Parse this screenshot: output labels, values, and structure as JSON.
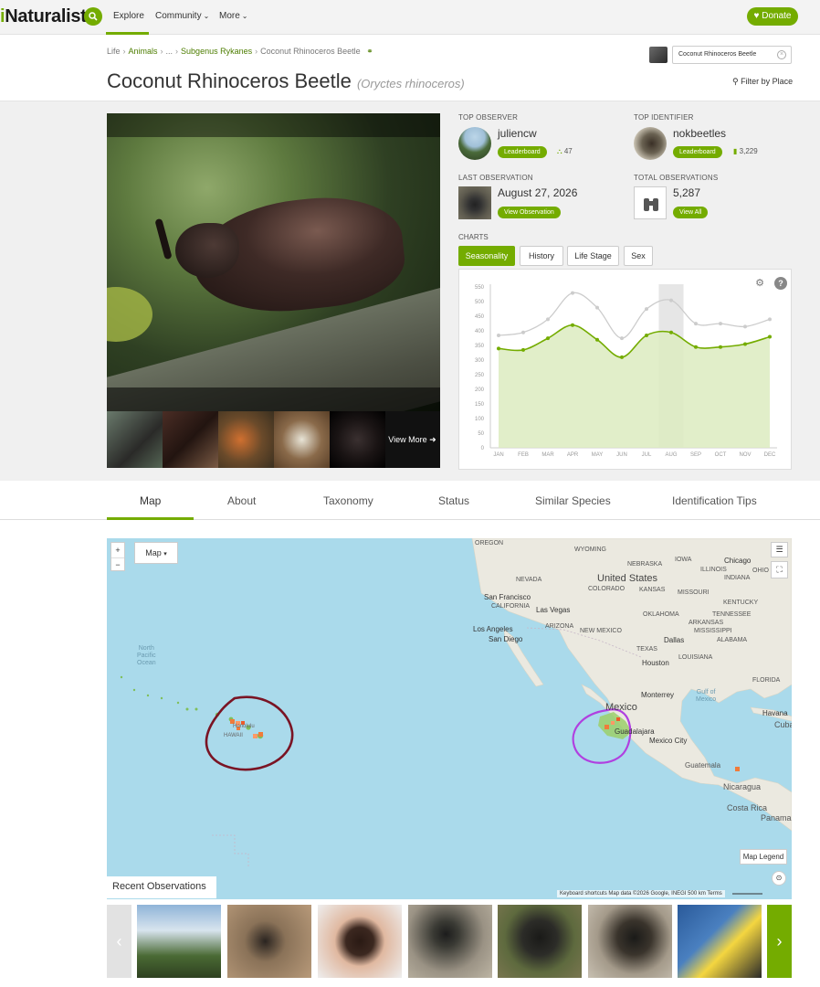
{
  "nav": {
    "logo_prefix": "i",
    "logo_rest": "Naturalist",
    "explore": "Explore",
    "community": "Community",
    "more": "More",
    "donate": "Donate"
  },
  "breadcrumb": {
    "life": "Life",
    "animals": "Animals",
    "ellipsis": "...",
    "subgenus": "Subgenus Rykanes",
    "current": "Coconut Rhinoceros Beetle"
  },
  "taxon": {
    "common_name": "Coconut Rhinoceros Beetle",
    "scientific_name": "(Oryctes rhinoceros)"
  },
  "search": {
    "value": "Coconut Rhinoceros Beetle"
  },
  "filter_by_place": "Filter by Place",
  "photos": {
    "view_more": "View More"
  },
  "stats": {
    "top_observer_label": "TOP OBSERVER",
    "top_observer_name": "juliencw",
    "top_observer_count": "47",
    "top_identifier_label": "TOP IDENTIFIER",
    "top_identifier_name": "nokbeetles",
    "top_identifier_count": "3,229",
    "leaderboard": "Leaderboard",
    "last_obs_label": "LAST OBSERVATION",
    "last_obs_date": "August 27, 2026",
    "view_observation": "View Observation",
    "total_obs_label": "TOTAL OBSERVATIONS",
    "total_obs_count": "5,287",
    "view_all": "View All"
  },
  "charts": {
    "label": "CHARTS",
    "tabs": [
      "Seasonality",
      "History",
      "Life Stage",
      "Sex"
    ]
  },
  "chart_data": {
    "type": "line",
    "categories": [
      "JAN",
      "FEB",
      "MAR",
      "APR",
      "MAY",
      "JUN",
      "JUL",
      "AUG",
      "SEP",
      "OCT",
      "NOV",
      "DEC"
    ],
    "series": [
      {
        "values": [
          385,
          395,
          440,
          530,
          480,
          375,
          475,
          505,
          425,
          425,
          415,
          440
        ],
        "color": "#cccccc"
      },
      {
        "values": [
          340,
          335,
          375,
          420,
          370,
          310,
          385,
          395,
          345,
          345,
          355,
          380
        ],
        "color": "#74ac00"
      }
    ],
    "yticks": [
      0,
      50,
      100,
      150,
      200,
      250,
      300,
      350,
      400,
      450,
      500,
      550
    ],
    "ylim": [
      0,
      560
    ],
    "highlight_category": "AUG"
  },
  "tabs": [
    "Map",
    "About",
    "Taxonomy",
    "Status",
    "Similar Species",
    "Identification Tips"
  ],
  "map": {
    "zoom_in": "+",
    "zoom_out": "−",
    "type_select": "Map",
    "legend": "Map Legend",
    "attribution": "Keyboard shortcuts   Map data ©2026 Google, INEGI   500 km   Terms",
    "labels": {
      "oregon": "OREGON",
      "wyoming": "WYOMING",
      "iowa": "IOWA",
      "chicago": "Chicago",
      "nebraska": "NEBRASKA",
      "illinois": "ILLINOIS",
      "ohio": "OHIO",
      "nevada": "NEVADA",
      "united_states": "United States",
      "indiana": "INDIANA",
      "colorado": "COLORADO",
      "kansas": "KANSAS",
      "missouri": "MISSOURI",
      "san_francisco": "San Francisco",
      "california": "CALIFORNIA",
      "las_vegas": "Las Vegas",
      "kentucky": "KENTUCKY",
      "oklahoma": "OKLAHOMA",
      "tennessee": "TENNESSEE",
      "arkansas": "ARKANSAS",
      "los_angeles": "Los Angeles",
      "arizona": "ARIZONA",
      "san_diego": "San Diego",
      "new_mexico": "NEW MEXICO",
      "dallas": "Dallas",
      "mississippi": "MISSISSIPPI",
      "alabama": "ALABAMA",
      "texas": "TEXAS",
      "louisiana": "LOUISIANA",
      "houston": "Houston",
      "florida": "FLORIDA",
      "north_pacific": "North\nPacific\nOcean",
      "monterrey": "Monterrey",
      "gulf": "Gulf of\nMexico",
      "mexico": "Mexico",
      "havana": "Havana",
      "cuba": "Cuba",
      "honolulu": "Honolulu",
      "hawaii": "HAWAII",
      "guadalajara": "Guadalajara",
      "mexico_city": "Mexico City",
      "guatemala": "Guatemala",
      "nicaragua": "Nicaragua",
      "costa_rica": "Costa Rica",
      "panama": "Panama"
    }
  },
  "recent_observations": "Recent Observations"
}
